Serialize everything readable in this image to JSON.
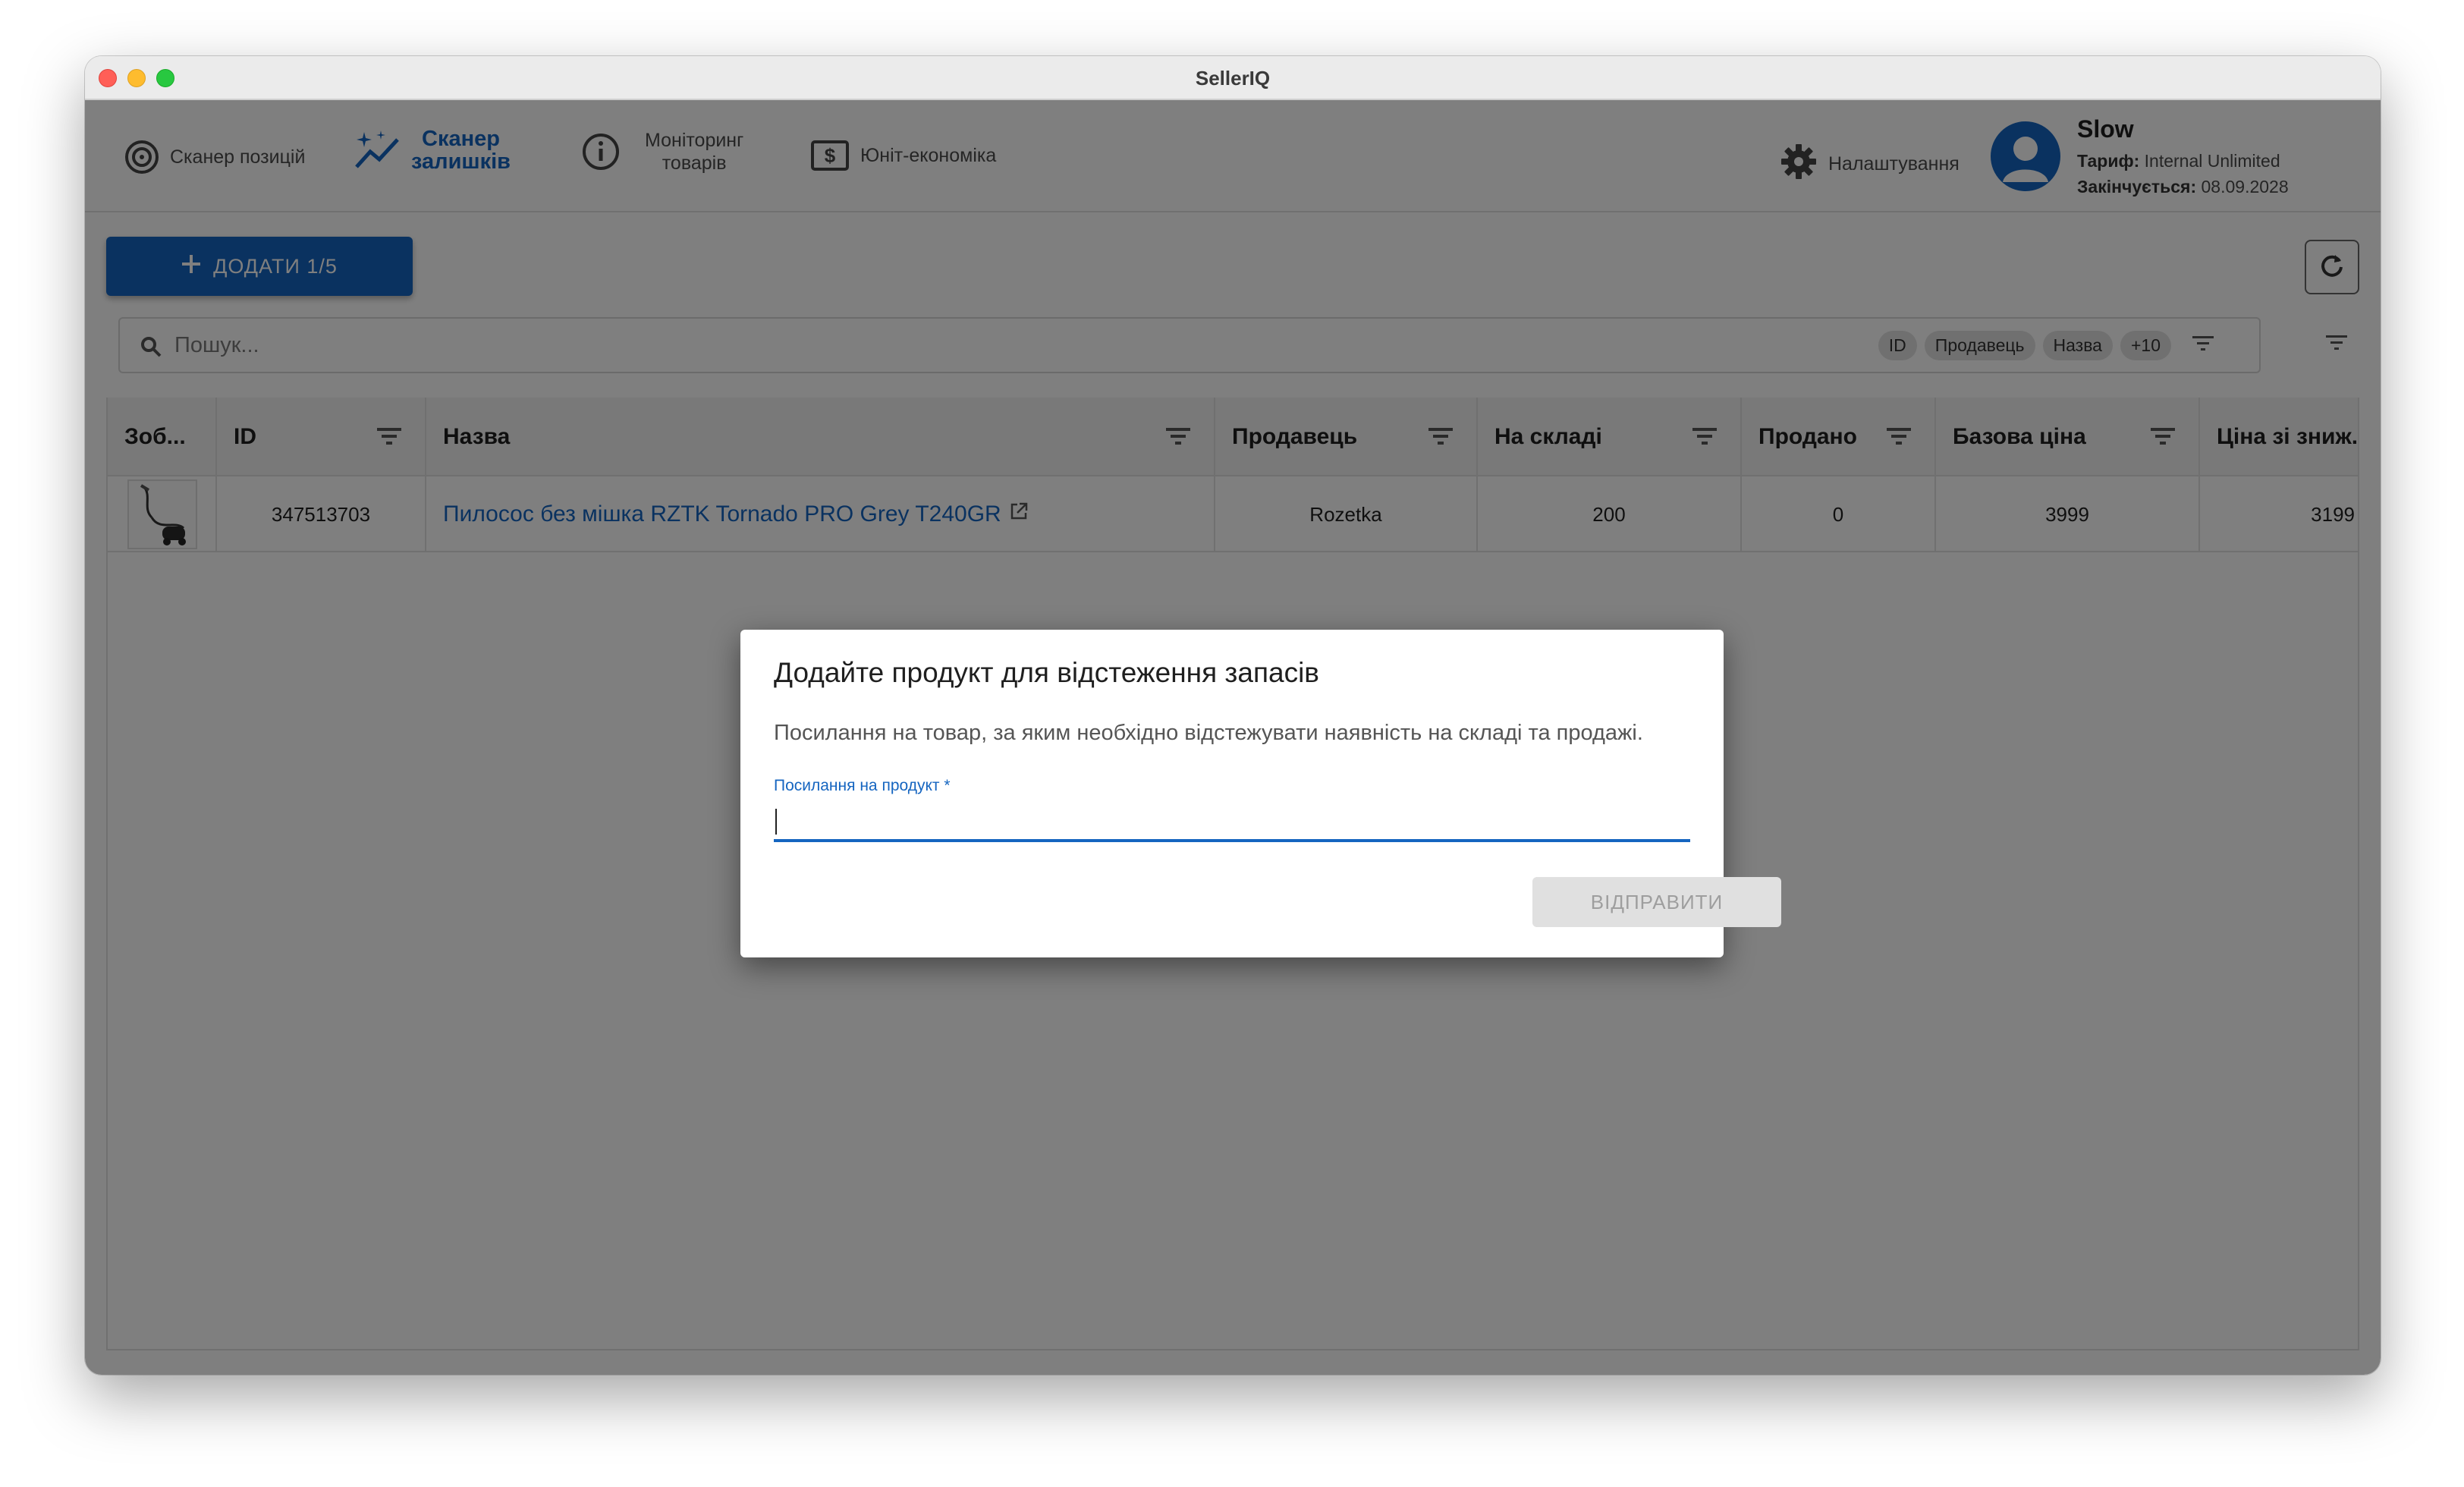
{
  "window": {
    "title": "SellerIQ"
  },
  "nav": {
    "items": [
      {
        "label": "Сканер позицій",
        "icon": "target-icon"
      },
      {
        "label_line1": "Сканер",
        "label_line2": "залишків",
        "icon": "sparkle-chart-icon",
        "active": true
      },
      {
        "label_line1": "Моніторинг",
        "label_line2": "товарів",
        "icon": "info-icon"
      },
      {
        "label": "Юніт-економіка",
        "icon": "dollar-icon"
      }
    ],
    "settings_label": "Налаштування"
  },
  "user": {
    "name": "Slow",
    "plan_label": "Тариф:",
    "plan_value": "Internal Unlimited",
    "expires_label": "Закінчується:",
    "expires_value": "08.09.2028"
  },
  "toolbar": {
    "add_label": "ДОДАТИ 1/5"
  },
  "search": {
    "placeholder": "Пошук...",
    "chips": [
      "ID",
      "Продавець",
      "Назва",
      "+10"
    ]
  },
  "table": {
    "headers": [
      "Зоб...",
      "ID",
      "Назва",
      "Продавець",
      "На складі",
      "Продано",
      "Базова ціна",
      "Ціна зі зниж."
    ],
    "rows": [
      {
        "id": "347513703",
        "name": "Пилосос без мішка RZTK Tornado PRO Grey T240GR",
        "seller": "Rozetka",
        "stock": "200",
        "sold": "0",
        "base_price": "3999",
        "discount_price": "3199"
      }
    ]
  },
  "dialog": {
    "title": "Додайте продукт для відстеження запасів",
    "text": "Посилання на товар, за яким необхідно відстежувати наявність на складі та продажі.",
    "field_label": "Посилання на продукт *",
    "field_value": "",
    "submit_label": "ВІДПРАВИТИ"
  },
  "colors": {
    "primary": "#1565c0",
    "overlay": "rgba(0,0,0,0.5)"
  }
}
